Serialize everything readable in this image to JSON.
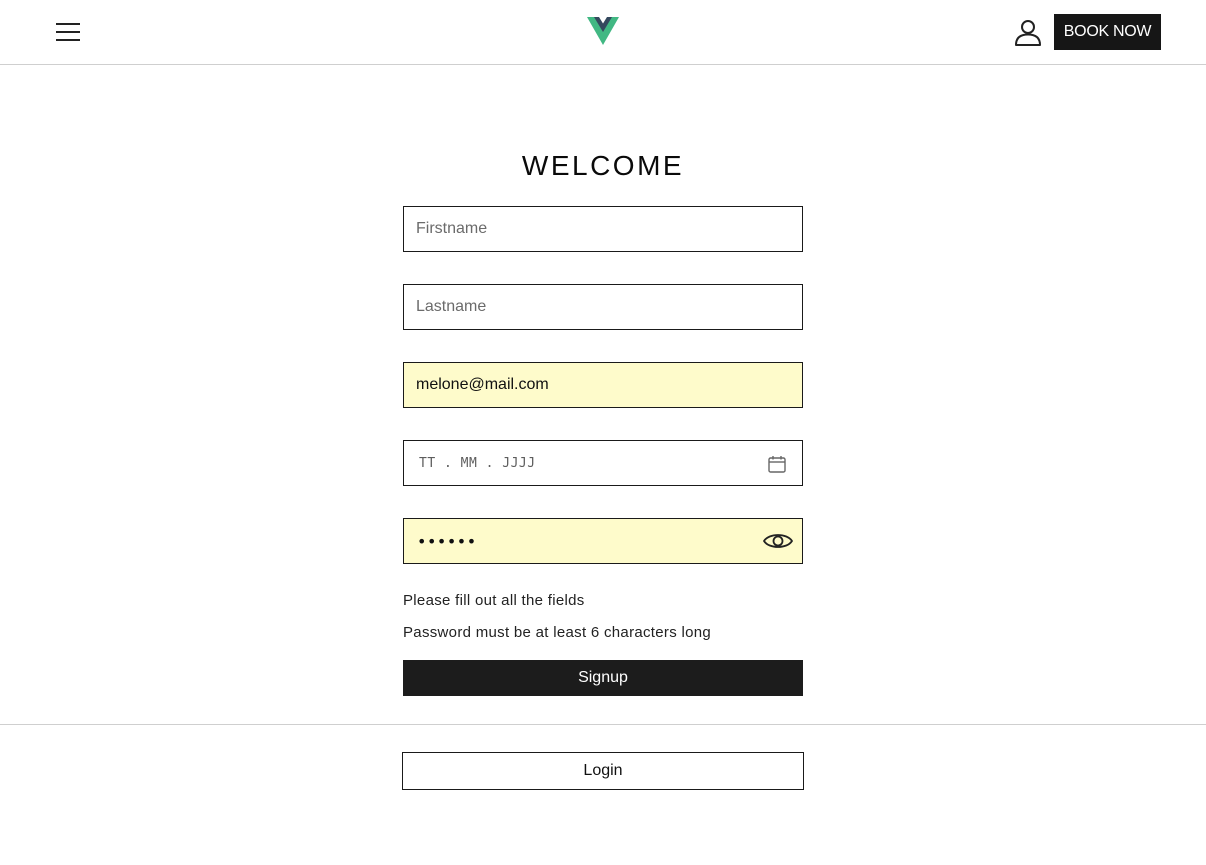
{
  "header": {
    "menu_icon": "hamburger-menu-icon",
    "logo_icon": "vue-logo-icon",
    "logo_colors": {
      "outer": "#41b883",
      "inner": "#34495e"
    },
    "user_icon": "user-icon",
    "book_now_label": "BOOK NOW"
  },
  "form": {
    "title": "WELCOME",
    "firstname": {
      "placeholder": "Firstname",
      "value": ""
    },
    "lastname": {
      "placeholder": "Lastname",
      "value": ""
    },
    "email": {
      "placeholder": "",
      "value": "melone@mail.com"
    },
    "birthdate": {
      "placeholder": "TT . MM . JJJJ",
      "icon": "calendar-icon"
    },
    "password": {
      "value": "••••••",
      "toggle_icon": "eye-icon"
    },
    "errors": {
      "fields": "Please fill out all the fields",
      "password": "Password must be at least 6 characters long"
    },
    "signup_label": "Signup",
    "login_label": "Login"
  },
  "colors": {
    "autofill_background": "#fefbcb",
    "button_dark": "#1c1c1c"
  }
}
